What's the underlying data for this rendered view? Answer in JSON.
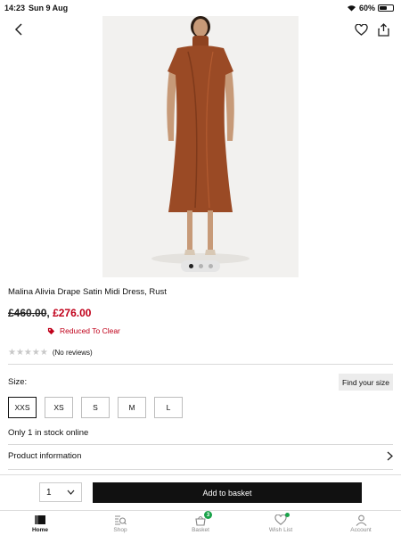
{
  "status_bar": {
    "time": "14:23",
    "date": "Sun 9 Aug",
    "battery": "60%",
    "battery_level": 0.6
  },
  "header": {
    "icons": [
      "chevron-left-icon",
      "heart-icon",
      "share-icon"
    ]
  },
  "product": {
    "title": "Malina Alivia Drape Satin Midi Dress, Rust",
    "price_was": "£460.00",
    "price_sep": ",",
    "price_now": "£276.00",
    "promo": "Reduced To Clear",
    "reviews": "(No reviews)",
    "rating": 0,
    "image_slide": 1,
    "image_count": 3
  },
  "sizes": {
    "label": "Size:",
    "find_size": "Find your size",
    "options": [
      "XXS",
      "XS",
      "S",
      "M",
      "L"
    ],
    "selected": "XXS"
  },
  "stock": "Only 1 in stock online",
  "product_info": "Product information",
  "purchase": {
    "quantity": "1",
    "add_to_basket": "Add to basket"
  },
  "tabs": [
    {
      "label": "Home",
      "icon": "home-icon",
      "active": true
    },
    {
      "label": "Shop",
      "icon": "shop-search-icon"
    },
    {
      "label": "Basket",
      "icon": "basket-icon",
      "badge": "3"
    },
    {
      "label": "Wish List",
      "icon": "heart-icon"
    },
    {
      "label": "Account",
      "icon": "account-icon"
    }
  ],
  "colors": {
    "sale_red": "#c0001a",
    "badge_green": "#1aa34a",
    "dress_rust": "#9a4a25"
  }
}
